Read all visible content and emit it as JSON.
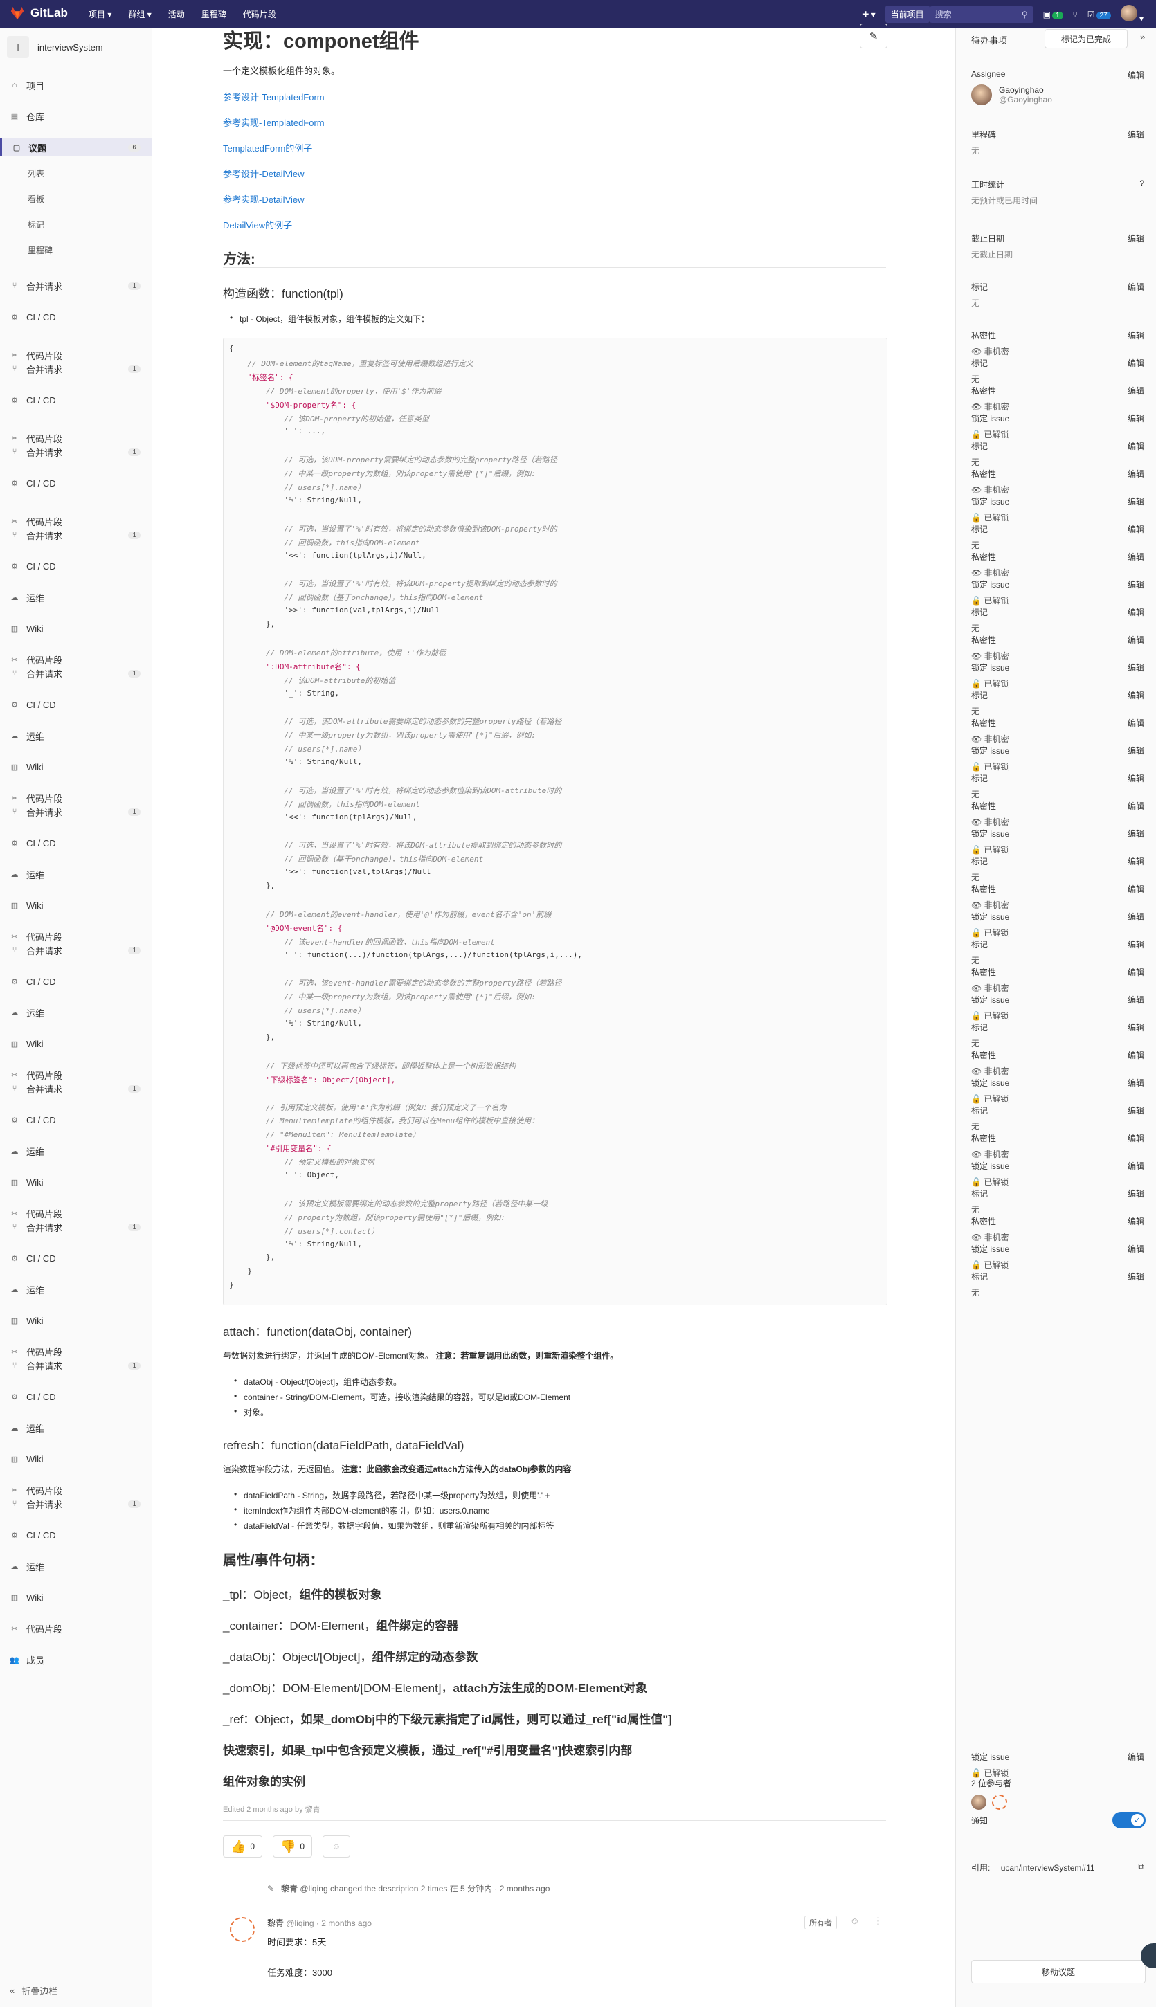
{
  "topbar": {
    "brand": "GitLab",
    "nav": [
      "项目 ▾",
      "群组 ▾",
      "活动",
      "里程碑",
      "代码片段"
    ],
    "scope": "当前项目",
    "search_placeholder": "搜索",
    "mr_count": "1",
    "todo_count": "27"
  },
  "sidebar": {
    "project_initial": "I",
    "project_name": "interviewSystem",
    "items_top": [
      {
        "label": "项目",
        "icon": "home-icon"
      },
      {
        "label": "仓库",
        "icon": "repo-icon"
      }
    ],
    "issues": {
      "label": "议题",
      "count": "6"
    },
    "issue_subs": [
      "列表",
      "看板",
      "标记",
      "里程碑"
    ],
    "merge": {
      "label": "合并请求",
      "count": "1"
    },
    "cicd": "CI / CD",
    "ops": "运维",
    "wiki": "Wiki",
    "snippets": "代码片段",
    "members": "成员",
    "collapse": "折叠边栏"
  },
  "main": {
    "title": "实现：componet组件",
    "intro": "一个定义模板化组件的对象。",
    "links": [
      "参考设计-TemplatedForm",
      "参考实现-TemplatedForm",
      "TemplatedForm的例子",
      "参考设计-DetailView",
      "参考实现-DetailView",
      "DetailView的例子"
    ],
    "methods_heading": "方法:",
    "ctor_heading": "构造函数：function(tpl)",
    "ctor_item": "tpl - Object，组件模板对象，组件模板的定义如下：",
    "code_lines": [
      "{",
      "    // DOM-element的tagName，重复标签可使用后缀数组进行定义",
      "    \"标签名\": {",
      "        // DOM-element的property，使用'$'作为前缀",
      "        \"$DOM-property名\": {",
      "            // 该DOM-property的初始值，任意类型",
      "            '_': ...,",
      "",
      "            // 可选，该DOM-property需要绑定的动态参数的完整property路径（若路径",
      "            // 中某一级property为数组，则该property需使用\"[*]\"后缀，例如:",
      "            // users[*].name）",
      "            '%': String/Null,",
      "",
      "            // 可选，当设置了'%'时有效，将绑定的动态参数值染到该DOM-property时的",
      "            // 回调函数，this指向DOM-element",
      "            '<<': function(tplArgs,i)/Null,",
      "",
      "            // 可选，当设置了'%'时有效，将该DOM-property提取到绑定的动态参数时的",
      "            // 回调函数（基于onchange），this指向DOM-element",
      "            '>>': function(val,tplArgs,i)/Null",
      "        },",
      "",
      "        // DOM-element的attribute，使用':'作为前缀",
      "        \":DOM-attribute名\": {",
      "            // 该DOM-attribute的初始值",
      "            '_': String,",
      "",
      "            // 可选，该DOM-attribute需要绑定的动态参数的完整property路径（若路径",
      "            // 中某一级property为数组，则该property需使用\"[*]\"后缀，例如:",
      "            // users[*].name）",
      "            '%': String/Null,",
      "",
      "            // 可选，当设置了'%'时有效，将绑定的动态参数值染到该DOM-attribute时的",
      "            // 回调函数，this指向DOM-element",
      "            '<<': function(tplArgs)/Null,",
      "",
      "            // 可选，当设置了'%'时有效，将该DOM-attribute提取到绑定的动态参数时的",
      "            // 回调函数（基于onchange），this指向DOM-element",
      "            '>>': function(val,tplArgs)/Null",
      "        },",
      "",
      "        // DOM-element的event-handler，使用'@'作为前缀，event名不含'on'前缀",
      "        \"@DOM-event名\": {",
      "            // 该event-handler的回调函数，this指向DOM-element",
      "            '_': function(...)/function(tplArgs,...)/function(tplArgs,i,...),",
      "",
      "            // 可选，该event-handler需要绑定的动态参数的完整property路径（若路径",
      "            // 中某一级property为数组，则该property需使用\"[*]\"后缀，例如:",
      "            // users[*].name）",
      "            '%': String/Null,",
      "        },",
      "",
      "        // 下级标签中还可以再包含下级标签，即模板整体上是一个树形数据结构",
      "        \"下级标签名\": Object/[Object],",
      "",
      "        // 引用预定义模板，使用'#'作为前缀（例如：我们预定义了一个名为",
      "        // MenuItemTemplate的组件模板，我们可以在Menu组件的模板中直接使用：",
      "        // \"#MenuItem\": MenuItemTemplate）",
      "        \"#引用变量名\": {",
      "            // 预定义模板的对象实例",
      "            '_': Object,",
      "",
      "            // 该预定义模板需要绑定的动态参数的完整property路径（若路径中某一级",
      "            // property为数组，则该property需使用\"[*]\"后缀，例如:",
      "            // users[*].contact）",
      "            '%': String/Null,",
      "        },",
      "    }",
      "}"
    ],
    "attach_heading": "attach：function(dataObj, container)",
    "attach_desc": "与数据对象进行绑定，并返回生成的DOM-Element对象。",
    "attach_note_label": "注意：",
    "attach_note": "若重复调用此函数，则重新渲染整个组件。",
    "attach_items": [
      "dataObj - Object/[Object]，组件动态参数。",
      "container - String/DOM-Element，可选，接收渲染结果的容器，可以是id或DOM-Element",
      "对象。"
    ],
    "refresh_heading": "refresh：function(dataFieldPath, dataFieldVal)",
    "refresh_desc": "渲染数据字段方法，无返回值。",
    "refresh_note_label": "注意：",
    "refresh_note": "此函数会改变通过attach方法传入的dataObj参数的内容",
    "refresh_items": [
      "dataFieldPath - String，数据字段路径，若路径中某一级property为数组，则使用'.' +",
      "itemIndex作为组件内部DOM-element的索引，例如：users.0.name",
      "dataFieldVal - 任意类型，数据字段值，如果为数组，则重新渲染所有相关的内部标签"
    ],
    "props_heading": "属性/事件句柄：",
    "props": [
      {
        "name": "_tpl：Object，",
        "desc": "组件的模板对象"
      },
      {
        "name": "_container：DOM-Element，",
        "desc": "组件绑定的容器"
      },
      {
        "name": "_dataObj：Object/[Object]，",
        "desc": "组件绑定的动态参数"
      },
      {
        "name": "_domObj：DOM-Element/[DOM-Element]，",
        "desc": "attach方法生成的DOM-Element对象"
      },
      {
        "name": "_ref：Object，",
        "desc": "如果_domObj中的下级元素指定了id属性，则可以通过_ref[\"id属性值\"]"
      },
      {
        "name": "",
        "desc": "快速索引，如果_tpl中包含预定义模板，通过_ref[\"#引用变量名\"]快速索引内部"
      },
      {
        "name": "",
        "desc": "组件对象的实例"
      }
    ],
    "edited": "Edited 2 months ago by 黎青",
    "thumbs_up": "0",
    "thumbs_down": "0",
    "activity_user": "黎青",
    "activity_text": "@liqing changed the description 2 times 在 5 分钟内 · 2 months ago",
    "comment_user": "黎青",
    "comment_meta": "@liqing · 2 months ago",
    "comment_role": "所有者",
    "comment_lines": [
      "时间要求：5天",
      "任务难度：3000"
    ]
  },
  "right": {
    "todo_label": "待办事项",
    "mark_done": "标记为已完成",
    "edit": "编辑",
    "assignee_label": "Assignee",
    "assignee_name": "Gaoyinghao",
    "assignee_handle": "@Gaoyinghao",
    "milestone_label": "里程碑",
    "none": "无",
    "time_label": "工时统计",
    "time_value": "无预计或已用时间",
    "due_label": "截止日期",
    "due_value": "无截止日期",
    "labels_label": "标记",
    "confidential_label": "私密性",
    "not_confidential": "非机密",
    "lock_label": "锁定 issue",
    "unlocked": "已解锁",
    "participants": "2 位参与者",
    "notify_label": "通知",
    "ref_label": "引用:",
    "ref_value": "ucan/interviewSystem#11",
    "move": "移动议题"
  }
}
